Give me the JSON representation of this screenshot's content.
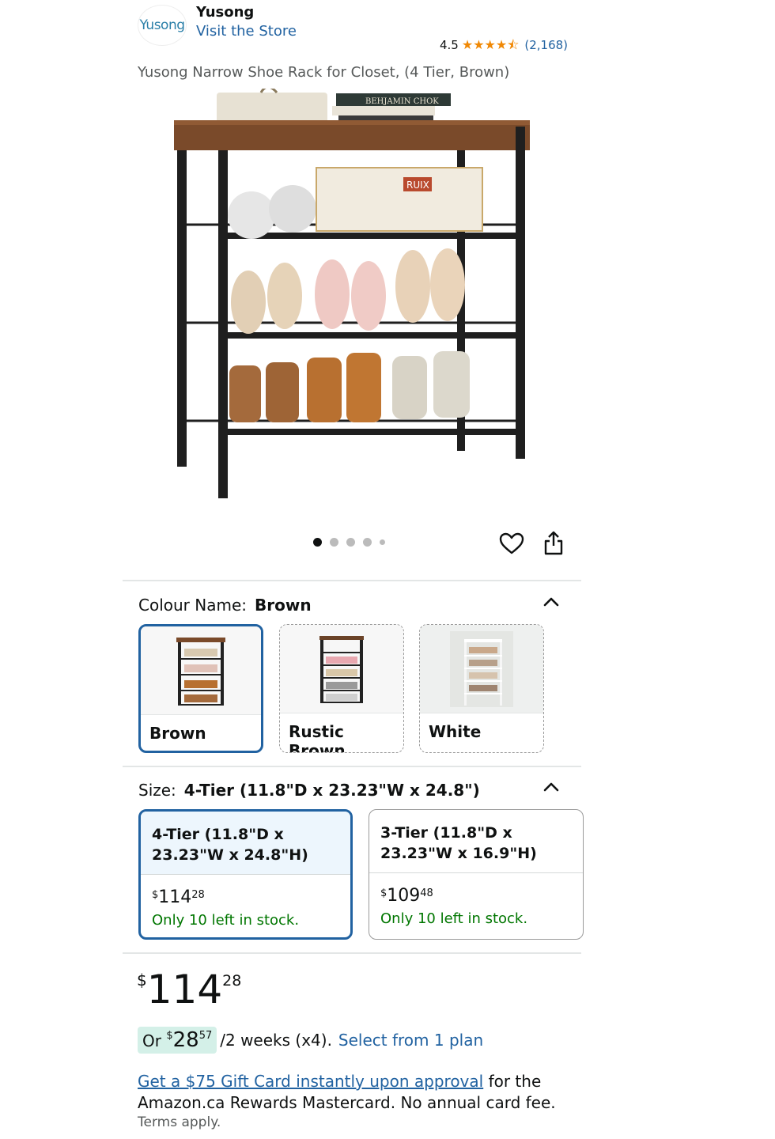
{
  "brand": {
    "logo_text": "Yusong",
    "name": "Yusong",
    "visit_store_label": "Visit the Store"
  },
  "rating": {
    "value": "4.5",
    "stars": 4.5,
    "count": "(2,168)"
  },
  "product_title": "Yusong Narrow Shoe Rack for Closet, (4 Tier, Brown)",
  "hero_image": {
    "basket_tag": "RUIX",
    "book_spine": "BEHJAMIN CHOK"
  },
  "carousel": {
    "total": 5,
    "active_index": 0
  },
  "colour": {
    "label": "Colour Name:",
    "selected": "Brown",
    "options": [
      {
        "label": "Brown",
        "selected": true
      },
      {
        "label": "Rustic Brown",
        "selected": false
      },
      {
        "label": "White",
        "selected": false
      }
    ]
  },
  "size": {
    "label": "Size:",
    "selected": "4-Tier (11.8\"D x 23.23\"W x 24.8\")",
    "options": [
      {
        "line1": "4-Tier (11.8\"D x",
        "line2": "23.23\"W x 24.8\"H)",
        "currency": "$",
        "price_whole": "114",
        "price_cents": "28",
        "stock": "Only 10 left in stock.",
        "selected": true
      },
      {
        "line1": "3-Tier (11.8\"D x",
        "line2": "23.23\"W x 16.9\"H)",
        "currency": "$",
        "price_whole": "109",
        "price_cents": "48",
        "stock": "Only 10 left in stock.",
        "selected": false
      }
    ]
  },
  "price": {
    "currency": "$",
    "whole": "114",
    "cents": "28"
  },
  "installment": {
    "prefix": "Or",
    "currency": "$",
    "whole": "28",
    "cents": "57",
    "suffix": "/2 weeks (x4).",
    "link": "Select from 1 plan"
  },
  "promo": {
    "link": "Get a $75 Gift Card instantly upon approval",
    "text": " for the Amazon.ca Rewards Mastercard. No annual card fee.",
    "terms": "Terms apply."
  },
  "colors": {
    "link": "#2162a1",
    "selected_border": "#2162a1",
    "star": "#f08804",
    "in_stock": "#007600",
    "installment_bg": "#d4f0e8"
  }
}
